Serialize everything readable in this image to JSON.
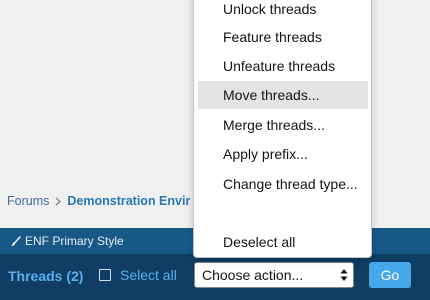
{
  "breadcrumb": {
    "items": [
      {
        "label": "Forums"
      },
      {
        "label": "Demonstration Envir"
      }
    ]
  },
  "style_chooser": {
    "label": "ENF Primary Style",
    "icon": "paintbrush-icon"
  },
  "inline_mod": {
    "threads_label": "Threads (2)",
    "select_all_label": "Select all",
    "select_all_checked": false,
    "action_select_value": "Choose action...",
    "go_label": "Go"
  },
  "dropdown": {
    "items": [
      {
        "label": "Unlock threads"
      },
      {
        "label": "Feature threads"
      },
      {
        "label": "Unfeature threads"
      },
      {
        "label": "Move threads...",
        "highlighted": true
      },
      {
        "label": "Merge threads..."
      },
      {
        "label": "Apply prefix..."
      },
      {
        "label": "Change thread type..."
      },
      {
        "label": ""
      },
      {
        "label": "Deselect all"
      }
    ]
  },
  "colors": {
    "style_bar": "#185886",
    "mod_bar": "#0f3d63",
    "accent_text": "#5ab0f2",
    "go_button": "#47a7eb",
    "breadcrumb_current": "#2577b1"
  }
}
